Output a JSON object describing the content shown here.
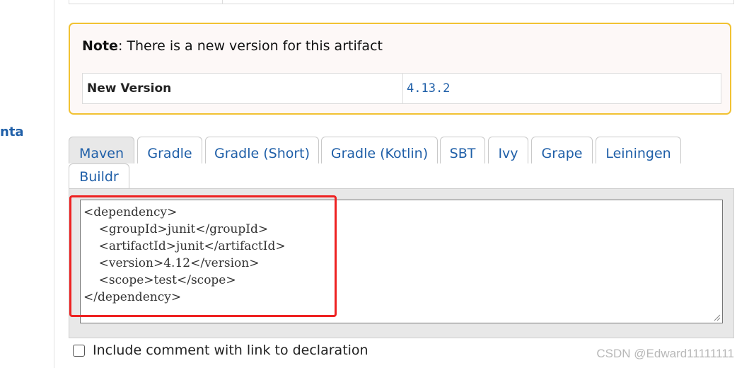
{
  "sidebar": {
    "fragment_text": "nta"
  },
  "note": {
    "label": "Note",
    "message": ": There is a new version for this artifact",
    "table": {
      "label": "New Version",
      "value": "4.13.2"
    }
  },
  "tabs": [
    {
      "label": "Maven",
      "active": true
    },
    {
      "label": "Gradle"
    },
    {
      "label": "Gradle (Short)"
    },
    {
      "label": "Gradle (Kotlin)"
    },
    {
      "label": "SBT"
    },
    {
      "label": "Ivy"
    },
    {
      "label": "Grape"
    },
    {
      "label": "Leiningen"
    },
    {
      "label": "Buildr"
    }
  ],
  "code": {
    "text": "<dependency>\n    <groupId>junit</groupId>\n    <artifactId>junit</artifactId>\n    <version>4.12</version>\n    <scope>test</scope>\n</dependency>"
  },
  "options": {
    "include_comment_label": "Include comment with link to declaration",
    "include_comment_checked": false
  },
  "watermark": "CSDN @Edward11111111",
  "colors": {
    "accent": "#1f5fa8",
    "note_border": "#f1c232",
    "highlight": "#ee2222"
  }
}
